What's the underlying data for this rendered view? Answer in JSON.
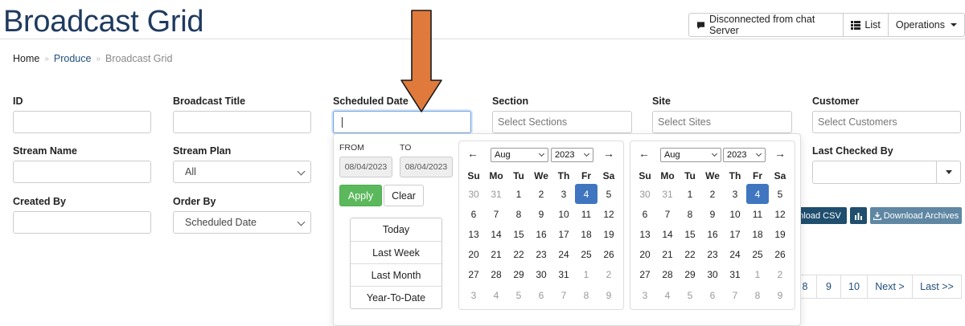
{
  "header": {
    "title": "Broadcast Grid",
    "chat_status": "Disconnected from chat Server",
    "list_label": "List",
    "operations_label": "Operations"
  },
  "breadcrumb": {
    "home": "Home",
    "produce": "Produce",
    "current": "Broadcast Grid",
    "sep": "»"
  },
  "filters": {
    "id_label": "ID",
    "broadcast_title_label": "Broadcast Title",
    "scheduled_date_label": "Scheduled Date",
    "section_label": "Section",
    "section_placeholder": "Select Sections",
    "site_label": "Site",
    "site_placeholder": "Select Sites",
    "customer_label": "Customer",
    "customer_placeholder": "Select Customers",
    "stream_name_label": "Stream Name",
    "stream_plan_label": "Stream Plan",
    "stream_plan_value": "All",
    "last_checked_by_label": "Last Checked By",
    "created_by_label": "Created By",
    "order_by_label": "Order By",
    "order_by_value": "Scheduled Date"
  },
  "picker": {
    "from_label": "FROM",
    "to_label": "TO",
    "from_value": "08/04/2023",
    "to_value": "08/04/2023",
    "apply_label": "Apply",
    "clear_label": "Clear",
    "ranges": [
      "Today",
      "Last Week",
      "Last Month",
      "Year-To-Date"
    ],
    "month": "Aug",
    "year": "2023",
    "weekdays": [
      "Su",
      "Mo",
      "Tu",
      "We",
      "Th",
      "Fr",
      "Sa"
    ],
    "prev_glyph": "←",
    "next_glyph": "→",
    "days_left": [
      [
        "30",
        "31",
        "1",
        "2",
        "3",
        "4",
        "5"
      ],
      [
        "6",
        "7",
        "8",
        "9",
        "10",
        "11",
        "12"
      ],
      [
        "13",
        "14",
        "15",
        "16",
        "17",
        "18",
        "19"
      ],
      [
        "20",
        "21",
        "22",
        "23",
        "24",
        "25",
        "26"
      ],
      [
        "27",
        "28",
        "29",
        "30",
        "31",
        "1",
        "2"
      ],
      [
        "3",
        "4",
        "5",
        "6",
        "7",
        "8",
        "9"
      ]
    ],
    "days_right": [
      [
        "30",
        "31",
        "1",
        "2",
        "3",
        "4",
        "5"
      ],
      [
        "6",
        "7",
        "8",
        "9",
        "10",
        "11",
        "12"
      ],
      [
        "13",
        "14",
        "15",
        "16",
        "17",
        "18",
        "19"
      ],
      [
        "20",
        "21",
        "22",
        "23",
        "24",
        "25",
        "26"
      ],
      [
        "27",
        "28",
        "29",
        "30",
        "31",
        "1",
        "2"
      ],
      [
        "3",
        "4",
        "5",
        "6",
        "7",
        "8",
        "9"
      ]
    ]
  },
  "actions": {
    "download_csv_partial": "nload CSV",
    "download_archives": "Download Archives"
  },
  "pagination": {
    "pages": [
      "8",
      "9",
      "10"
    ],
    "next_label": "Next >",
    "last_label": "Last >>"
  },
  "colors": {
    "title": "#1f3a5f",
    "apply": "#5cb85c",
    "selected_day": "#3f76bf",
    "arrow_fill": "#e07a3c"
  }
}
